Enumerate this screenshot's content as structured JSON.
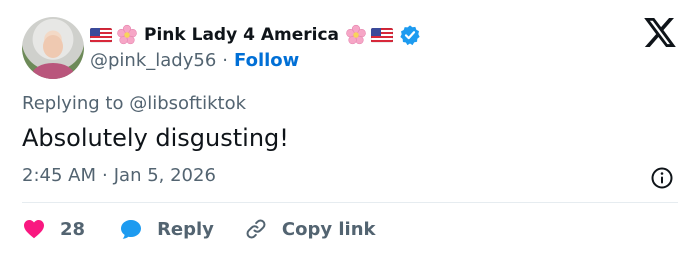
{
  "tweet": {
    "display_name": "Pink Lady 4 America",
    "handle": "@pink_lady56",
    "separator": "·",
    "follow_label": "Follow",
    "replying_to": "Replying to @libsoftiktok",
    "text": "Absolutely disgusting!",
    "time": "2:45 AM",
    "date": "Jan 5, 2026"
  },
  "actions": {
    "likes_count": "28",
    "reply_label": "Reply",
    "copy_link_label": "Copy link"
  },
  "icons": {
    "flag": "us-flag-icon",
    "blossom": "cherry-blossom-icon",
    "verified": "verified-badge-icon",
    "brand": "x-logo-icon",
    "info": "info-icon",
    "like": "heart-icon",
    "reply": "speech-bubble-icon",
    "link": "link-icon"
  },
  "colors": {
    "text": "#0f1419",
    "secondary_text": "#536471",
    "link": "#006fd6",
    "verified": "#1d9bf0",
    "like": "#f91880",
    "reply": "#1d9bf0",
    "divider": "#e6ecf0",
    "background": "#ffffff"
  }
}
